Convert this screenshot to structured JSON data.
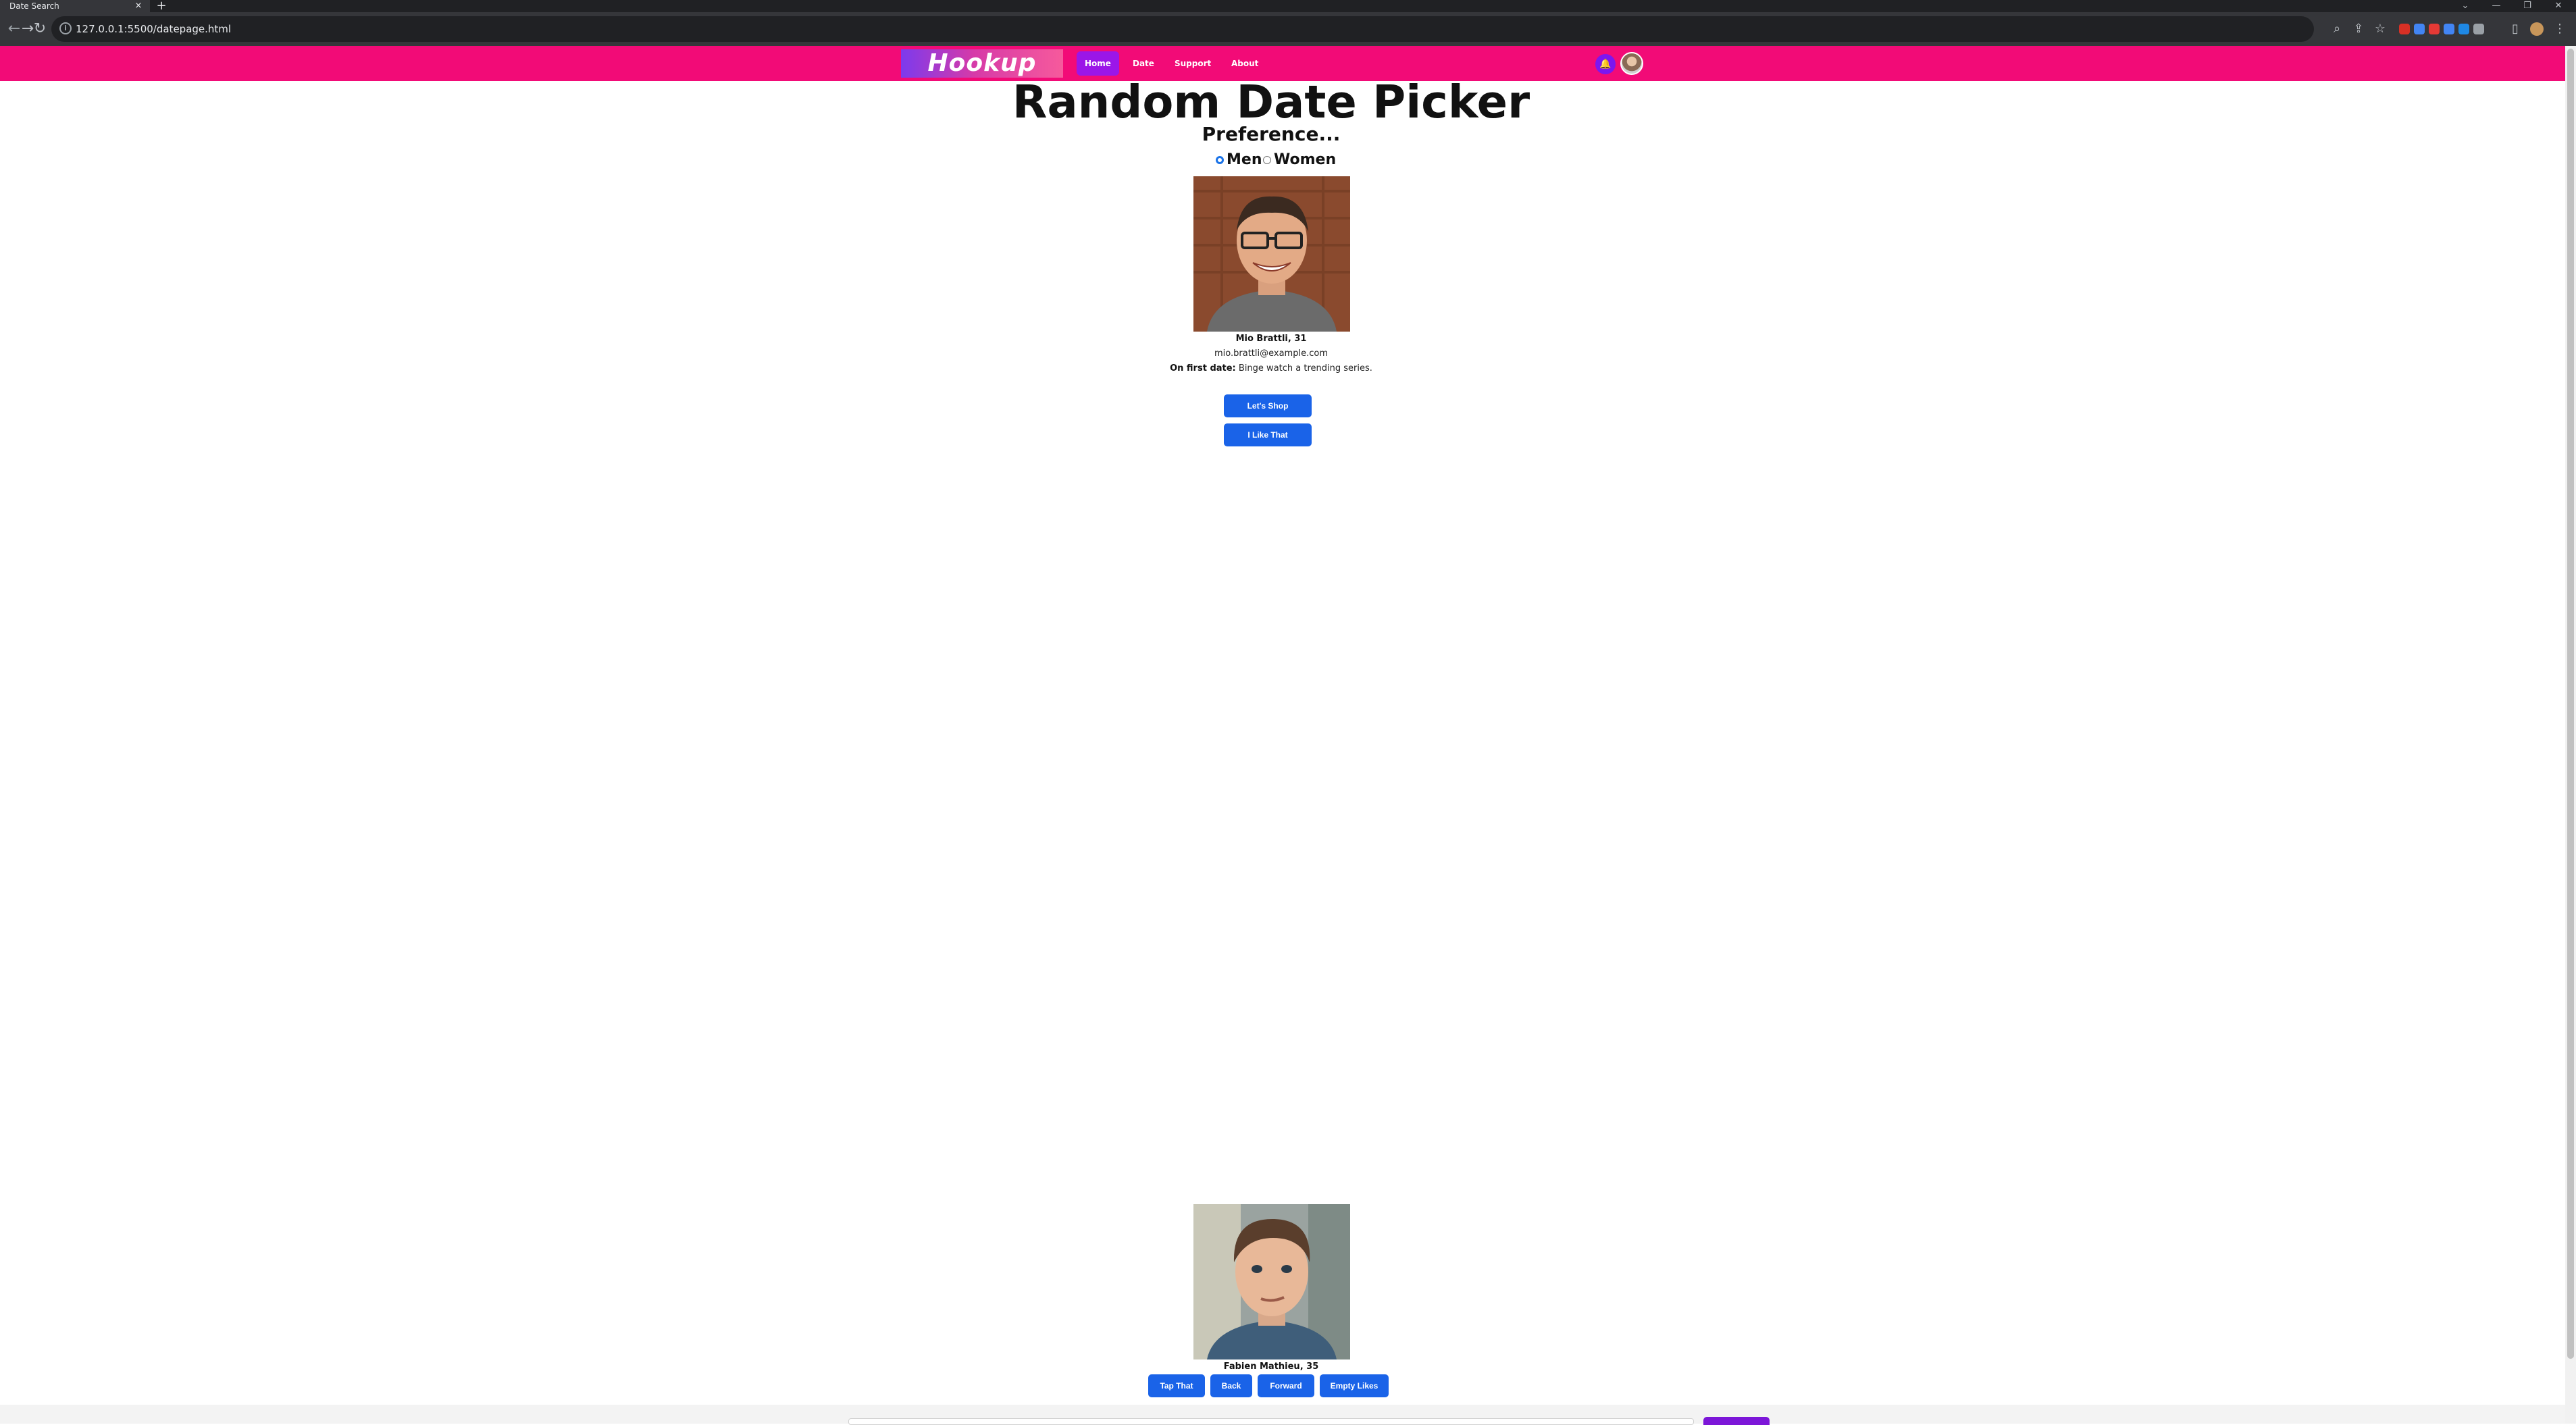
{
  "browser": {
    "tab_title": "Date Search",
    "tab_close": "×",
    "new_tab": "+",
    "url": "127.0.0.1:5500/datepage.html",
    "info_icon": "i",
    "window_controls": [
      "⌄",
      "—",
      "❐",
      "✕"
    ],
    "nav": {
      "back": "←",
      "forward": "→",
      "reload": "↻"
    },
    "toolbar_icons": {
      "zoom": "⌕",
      "share": "⇪",
      "star": "☆",
      "sidepanel": "▯",
      "menu": "⋮"
    },
    "extension_colors": [
      "#d93025",
      "#4285f4",
      "#e53935",
      "#4285f4",
      "#1e88e5",
      "#9aa0a6"
    ]
  },
  "navbar": {
    "logo": "Hookup",
    "links": [
      {
        "label": "Home",
        "active": true
      },
      {
        "label": "Date",
        "active": false
      },
      {
        "label": "Support",
        "active": false
      },
      {
        "label": "About",
        "active": false
      }
    ],
    "bell_icon": "🔔"
  },
  "page": {
    "title": "Random Date Picker",
    "preference_label": "Preference...",
    "options": [
      {
        "label": "Men",
        "selected": true
      },
      {
        "label": "Women",
        "selected": false
      }
    ]
  },
  "profile": {
    "name": "Mio Brattli, 31",
    "email": "mio.brattli@example.com",
    "first_date_label": "On first date:",
    "first_date_value": "Binge watch a trending series.",
    "buttons": {
      "shop": "Let's Shop",
      "like": "I Like That"
    }
  },
  "second_profile": {
    "name": "Fabien Mathieu, 35",
    "buttons": {
      "tap": "Tap That",
      "back": "Back",
      "forward": "Forward",
      "empty": "Empty Likes"
    }
  }
}
